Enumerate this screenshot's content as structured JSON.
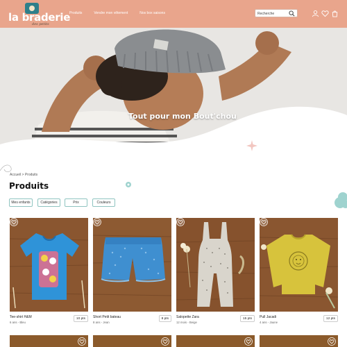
{
  "header": {
    "logo": {
      "title": "la braderie",
      "subtitle": "des petits"
    },
    "nav": [
      "Produits",
      "Vendre mon vêtement",
      "Nos box saisons"
    ],
    "search": {
      "placeholder": "Recherche",
      "value": ""
    },
    "icons": [
      "user-icon",
      "heart-icon",
      "cart-icon"
    ],
    "colors": {
      "header_bg": "#e9a58c",
      "accent": "#8fc4c0"
    }
  },
  "hero": {
    "title": "Tout pour mon Bout'chou"
  },
  "breadcrumb": {
    "home": "Accueil",
    "separator": ">",
    "current": "Produits"
  },
  "page_title": "Produits",
  "filters": [
    "Mes enfants",
    "Catégories",
    "Prix",
    "Couleurs"
  ],
  "products": [
    {
      "name": "Tee-shirt H&M",
      "meta": "6 ans - Bleu",
      "price": "10 pts"
    },
    {
      "name": "Short Petit bateau",
      "meta": "8 ans - Jean",
      "price": "8 pts"
    },
    {
      "name": "Salopette Zara",
      "meta": "12 mois - Beige",
      "price": "15 pts"
    },
    {
      "name": "Pull Jacadi",
      "meta": "4 ans - Jaune",
      "price": "12 pts"
    }
  ]
}
